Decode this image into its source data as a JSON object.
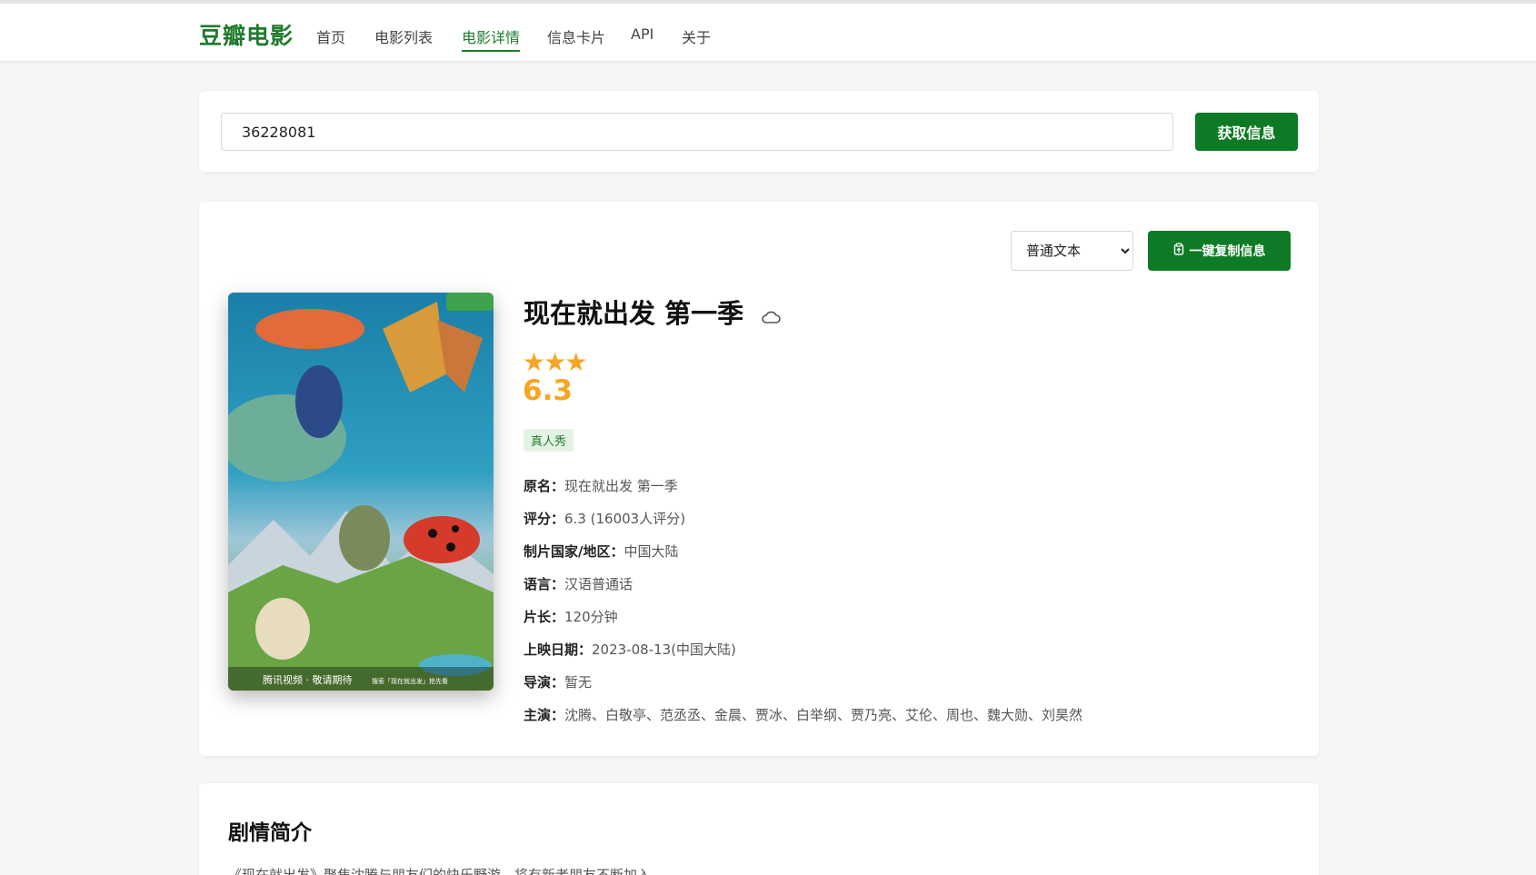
{
  "nav": {
    "brand": "豆瓣电影",
    "items": [
      "首页",
      "电影列表",
      "电影详情",
      "信息卡片",
      "API",
      "关于"
    ],
    "active": "电影详情"
  },
  "search": {
    "value": "36228081",
    "button_label": "获取信息"
  },
  "toolbar": {
    "format_selected": "普通文本",
    "copy_label": "一键复制信息"
  },
  "movie": {
    "title": "现在就出发 第一季",
    "stars": "★★★",
    "rating": "6.3",
    "tag": "真人秀",
    "poster_texts": {
      "bottom_left": "腾讯视频 · 敬请期待",
      "bottom_right": "搜索「现在就出发」抢先看"
    },
    "info": [
      {
        "key": "原名：",
        "value": "现在就出发 第一季"
      },
      {
        "key": "评分：",
        "value": "6.3 (16003人评分)"
      },
      {
        "key": "制片国家/地区：",
        "value": "中国大陆"
      },
      {
        "key": "语言：",
        "value": "汉语普通话"
      },
      {
        "key": "片长：",
        "value": "120分钟"
      },
      {
        "key": "上映日期：",
        "value": "2023-08-13(中国大陆)"
      },
      {
        "key": "导演：",
        "value": "暂无"
      },
      {
        "key": "主演：",
        "value": "沈腾、白敬亭、范丞丞、金晨、贾冰、白举纲、贾乃亮、艾伦、周也、魏大勋、刘昊然"
      }
    ]
  },
  "plot": {
    "heading": "剧情简介",
    "text": "《现在就出发》聚焦沈腾与朋友们的快乐野游，将有新老朋友不断加入"
  },
  "colors": {
    "brand_green": "#0e7a25",
    "star_orange": "#f5a623",
    "tag_bg": "#e3f3e4"
  }
}
